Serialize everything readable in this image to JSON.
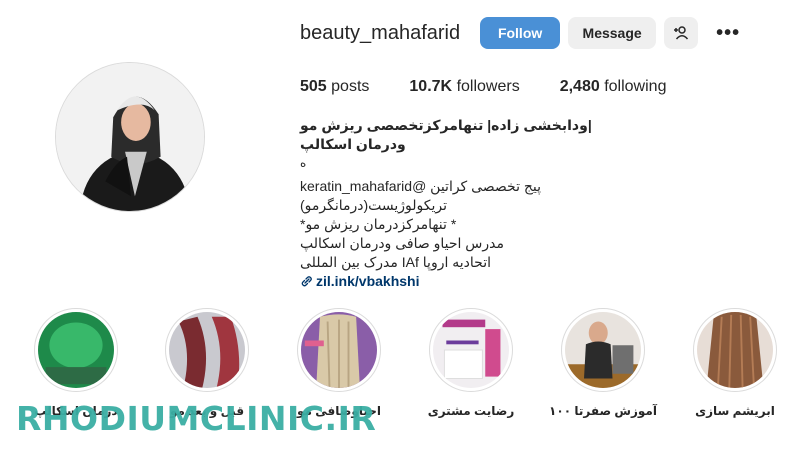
{
  "profile": {
    "username": "beauty_mahafarid",
    "follow_label": "Follow",
    "message_label": "Message",
    "stats": {
      "posts_count": "505",
      "posts_label": "posts",
      "followers_count": "10.7K",
      "followers_label": "followers",
      "following_count": "2,480",
      "following_label": "following"
    },
    "bio": {
      "full_name": "|ودابخشی زاده| تنهامرکزتخصصی ریزش مو ودرمان اسکالپ",
      "line_o": "ه",
      "line1": "پیج تخصصی کراتین @keratin_mahafarid",
      "line2": "تریکولوژیست(درمانگرمو)",
      "line3": "* تنهامرکزدرمان ریزش مو*",
      "line4": "مدرس احیاو صافی ودرمان اسکالپ",
      "line5": "اتحادیه اروپا IAf مدرک بین المللی",
      "link": "zil.ink/vbakhshi"
    }
  },
  "highlights": [
    {
      "label": "درمان اسکالپ"
    },
    {
      "label": "قبل و بعد مو"
    },
    {
      "label": "احیاوصافی مو"
    },
    {
      "label": "رضایت مشتری"
    },
    {
      "label": "آموزش صفرتا ۱۰۰"
    },
    {
      "label": "ابریشم سازی"
    }
  ],
  "watermark": "RHODIUMCLINIC.IR",
  "colors": {
    "follow_button": "#4a90d6",
    "secondary_button": "#efefef",
    "link": "#00376b",
    "watermark": "#3aaea4"
  },
  "icons": [
    "add-person-icon",
    "more-icon",
    "link-icon"
  ]
}
